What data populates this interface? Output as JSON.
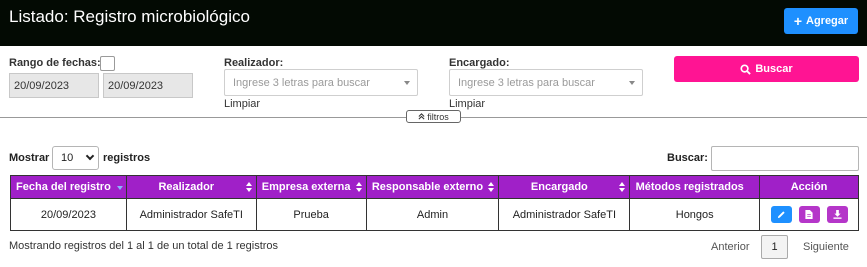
{
  "header": {
    "title": "Listado: Registro microbiológico",
    "add_label": "Agregar"
  },
  "filters": {
    "range_label": "Rango de fechas:",
    "date_from": "20/09/2023",
    "date_to": "20/09/2023",
    "realizador_label": "Realizador:",
    "realizador_placeholder": "Ingrese 3 letras para buscar",
    "realizador_clear": "Limpiar",
    "encargado_label": "Encargado:",
    "encargado_placeholder": "Ingrese 3 letras para buscar",
    "encargado_clear": "Limpiar",
    "search_button": "Buscar",
    "toggle_label": "filtros"
  },
  "table_controls": {
    "show_label": "Mostrar",
    "page_length": "10",
    "records_label": "registros",
    "search_label": "Buscar:"
  },
  "table": {
    "columns": [
      "Fecha del registro",
      "Realizador",
      "Empresa externa",
      "Responsable externo",
      "Encargado",
      "Métodos registrados",
      "Acción"
    ],
    "rows": [
      [
        "20/09/2023",
        "Administrador SafeTI",
        "Prueba",
        "Admin",
        "Administrador SafeTI",
        "Hongos"
      ]
    ]
  },
  "footer": {
    "info": "Mostrando registros del 1 al 1 de un total de 1 registros",
    "prev": "Anterior",
    "page": "1",
    "next": "Siguiente"
  },
  "colors": {
    "header_bg": "#030a03",
    "primary": "#1e90ff",
    "pink": "#ff1493",
    "purple": "#a020c8"
  }
}
